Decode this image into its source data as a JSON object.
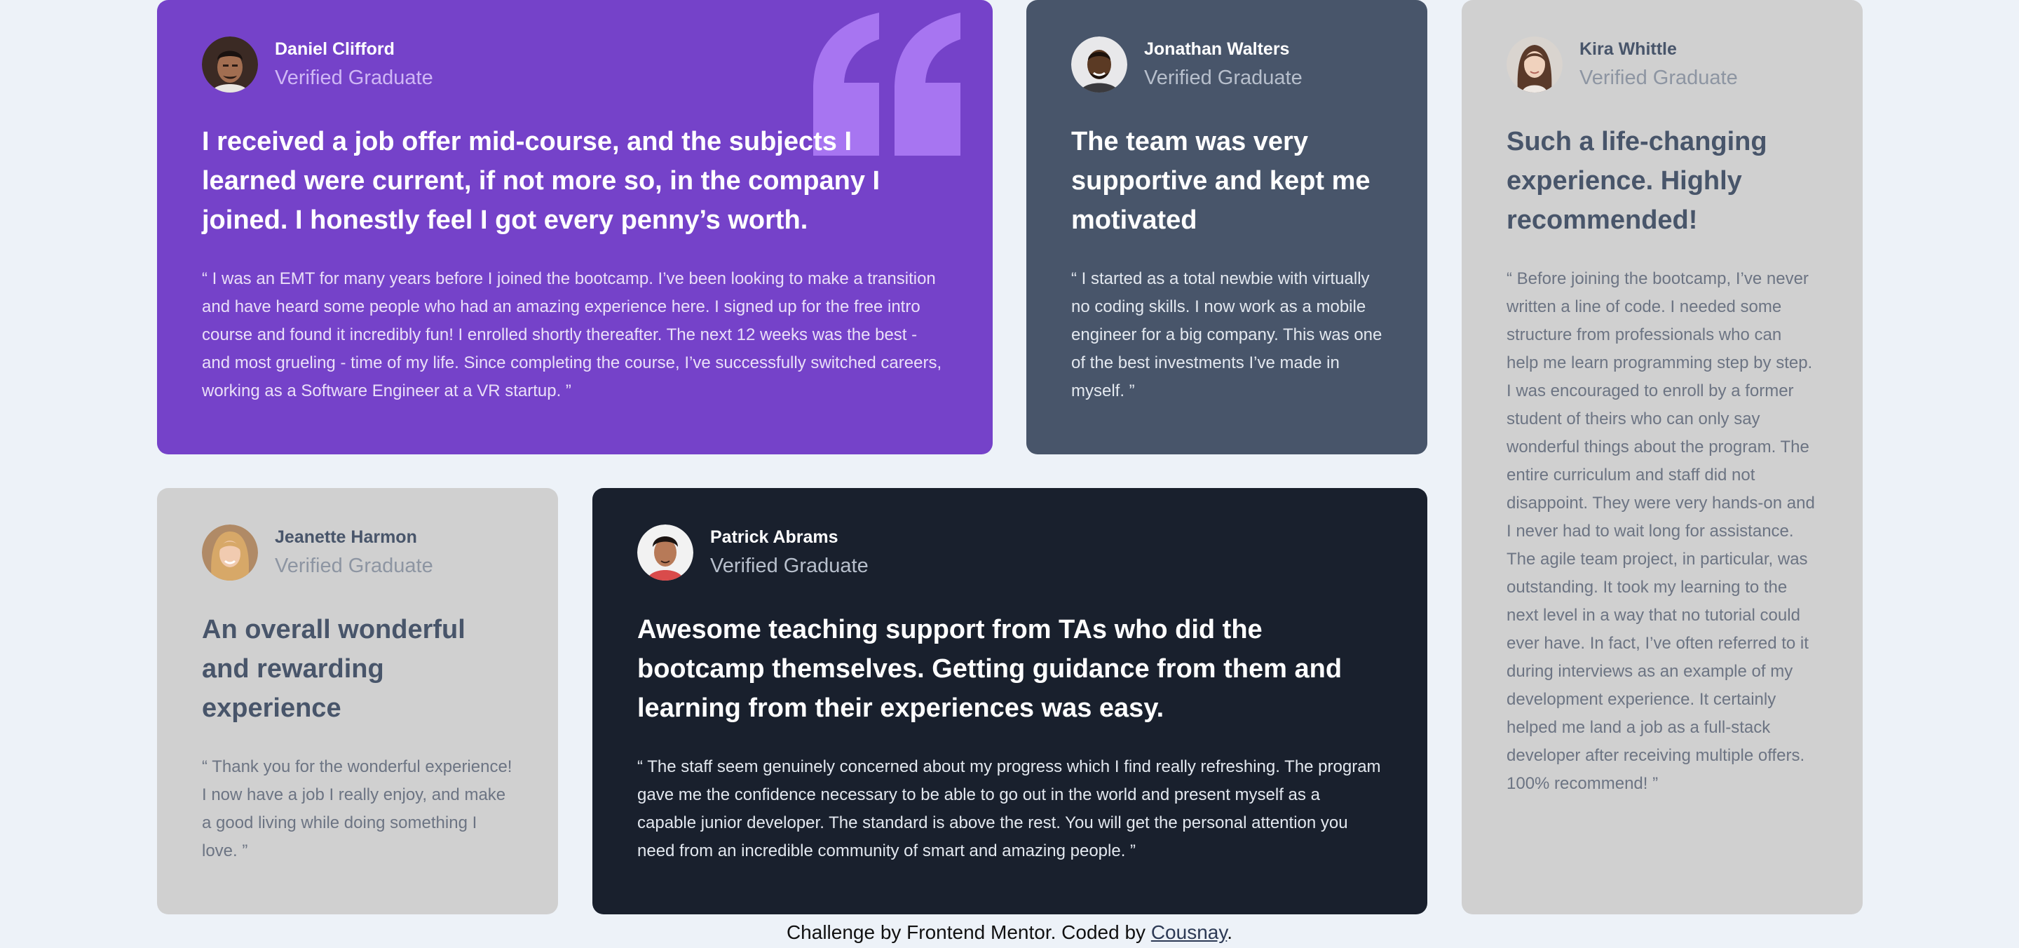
{
  "colors": {
    "page_background": "#edf2f8",
    "purple_card": "#7542c9",
    "slate_card": "#48556a",
    "grey_card": "#d0d0d0",
    "dark_card": "#19202d",
    "quote_mark": "#a775f1"
  },
  "testimonials": [
    {
      "name": "Daniel Clifford",
      "role": "Verified Graduate",
      "avatar_icon": "avatar-daniel",
      "headline": "I received a job offer mid-course, and the subjects I learned were current, if not more so, in the company I joined. I honestly feel I got every penny’s worth.",
      "body": "“ I was an EMT for many years before I joined the bootcamp. I’ve been looking to make a transition and have heard some people who had an amazing experience here. I signed up for the free intro course and found it incredibly fun! I enrolled shortly thereafter. The next 12 weeks was the best - and most grueling - time of my life. Since completing the course, I’ve successfully switched careers, working as a Software Engineer at a VR startup. ”"
    },
    {
      "name": "Jonathan Walters",
      "role": "Verified Graduate",
      "avatar_icon": "avatar-jonathan",
      "headline": "The team was very supportive and kept me motivated",
      "body": "“ I started as a total newbie with virtually no coding skills. I now work as a mobile engineer for a big company. This was one of the best investments I’ve made in myself. ”"
    },
    {
      "name": "Kira Whittle",
      "role": "Verified Graduate",
      "avatar_icon": "avatar-kira",
      "headline": "Such a life-changing experience. Highly recommended!",
      "body": "“ Before joining the bootcamp, I’ve never written a line of code. I needed some structure from professionals who can help me learn programming step by step. I was encouraged to enroll by a former student of theirs who can only say wonderful things about the program. The entire curriculum and staff did not disappoint. They were very hands-on and I never had to wait long for assistance. The agile team project, in particular, was outstanding. It took my learning to the next level in a way that no tutorial could ever have. In fact, I’ve often referred to it during interviews as an example of my development experience. It certainly helped me land a job as a full-stack developer after receiving multiple offers. 100% recommend! ”"
    },
    {
      "name": "Jeanette Harmon",
      "role": "Verified Graduate",
      "avatar_icon": "avatar-jeanette",
      "headline": "An overall wonderful and rewarding experience",
      "body": "“ Thank you for the wonderful experience! I now have a job I really enjoy, and make a good living while doing something I love. ”"
    },
    {
      "name": "Patrick Abrams",
      "role": "Verified Graduate",
      "avatar_icon": "avatar-patrick",
      "headline": "Awesome teaching support from TAs who did the bootcamp themselves. Getting guidance from them and learning from their experiences was easy.",
      "body": "“ The staff seem genuinely concerned about my progress which I find really refreshing. The program gave me the confidence necessary to be able to go out in the world and present myself as a capable junior developer. The standard is above the rest. You will get the personal attention you need from an incredible community of smart and amazing people. ”"
    }
  ],
  "decoration": {
    "quote_icon": "quotation-mark-icon"
  },
  "footer": {
    "prefix": "Challenge by Frontend Mentor. Coded by ",
    "link_text": "Cousnay",
    "suffix": "."
  }
}
